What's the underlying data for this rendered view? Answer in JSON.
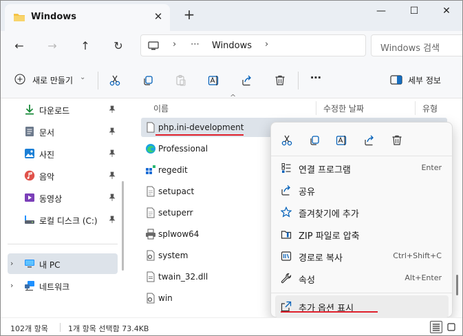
{
  "window": {
    "tab_title": "Windows",
    "tab_close": "✕",
    "tab_add": "+",
    "minimize": "—",
    "maximize": "☐",
    "close": "✕"
  },
  "nav": {
    "back": "←",
    "forward": "→",
    "up": "↑",
    "refresh": "↻",
    "addr_sep1": "›",
    "addr_more": "⋯",
    "addr_crumb": "Windows",
    "addr_sep2": "›",
    "search_placeholder": "Windows 검색"
  },
  "toolbar": {
    "new_label": "새로 만들기",
    "new_chevron": "⌄",
    "more": "⋯",
    "details_label": "세부 정보",
    "icons": [
      "cut-icon",
      "copy-icon",
      "paste-icon",
      "rename-icon",
      "share-icon",
      "delete-icon"
    ]
  },
  "sidebar": {
    "items": [
      {
        "label": "다운로드",
        "icon": "download-icon",
        "pinned": true
      },
      {
        "label": "문서",
        "icon": "documents-icon",
        "pinned": true
      },
      {
        "label": "사진",
        "icon": "pictures-icon",
        "pinned": true
      },
      {
        "label": "음악",
        "icon": "music-icon",
        "pinned": true
      },
      {
        "label": "동영상",
        "icon": "videos-icon",
        "pinned": true
      },
      {
        "label": "로컬 디스크 (C:)",
        "icon": "drive-icon",
        "pinned": true
      }
    ],
    "tree": [
      {
        "label": "내 PC",
        "icon": "this-pc-icon",
        "selected": true
      },
      {
        "label": "네트워크",
        "icon": "network-icon",
        "selected": false
      }
    ],
    "expander": "›"
  },
  "columns": {
    "name": "이름",
    "modified": "수정한 날짜",
    "type": "유형",
    "sort_indicator": "^"
  },
  "files": [
    {
      "name": "php.ini-development",
      "icon": "text-file-icon",
      "selected": true
    },
    {
      "name": "Professional",
      "icon": "edge-icon",
      "selected": false
    },
    {
      "name": "regedit",
      "icon": "regedit-icon",
      "selected": false
    },
    {
      "name": "setupact",
      "icon": "text-file-icon",
      "selected": false
    },
    {
      "name": "setuperr",
      "icon": "text-file-icon",
      "selected": false
    },
    {
      "name": "splwow64",
      "icon": "printer-icon",
      "selected": false
    },
    {
      "name": "system",
      "icon": "settings-file-icon",
      "selected": false
    },
    {
      "name": "twain_32.dll",
      "icon": "dll-file-icon",
      "selected": false
    },
    {
      "name": "win",
      "icon": "settings-file-icon",
      "selected": false
    }
  ],
  "context_menu": {
    "quick_actions": [
      "cut-icon",
      "copy-icon",
      "rename-icon",
      "share-icon",
      "delete-icon"
    ],
    "items": [
      {
        "label": "연결 프로그램",
        "shortcut": "Enter",
        "icon": "open-with-icon"
      },
      {
        "label": "공유",
        "shortcut": "",
        "icon": "share-icon"
      },
      {
        "label": "즐겨찾기에 추가",
        "shortcut": "",
        "icon": "star-icon"
      },
      {
        "label": "ZIP 파일로 압축",
        "shortcut": "",
        "icon": "zip-icon"
      },
      {
        "label": "경로로 복사",
        "shortcut": "Ctrl+Shift+C",
        "icon": "copy-path-icon"
      },
      {
        "label": "속성",
        "shortcut": "Alt+Enter",
        "icon": "properties-icon"
      }
    ],
    "more_options": {
      "label": "추가 옵션 표시",
      "icon": "more-options-icon"
    }
  },
  "status": {
    "item_count": "102개 항목",
    "selection": "1개 항목 선택함 73.4KB"
  },
  "colors": {
    "accent": "#005fb8",
    "folder": "#f4c245",
    "highlight": "#e0202c",
    "selection": "#dde3ea"
  }
}
